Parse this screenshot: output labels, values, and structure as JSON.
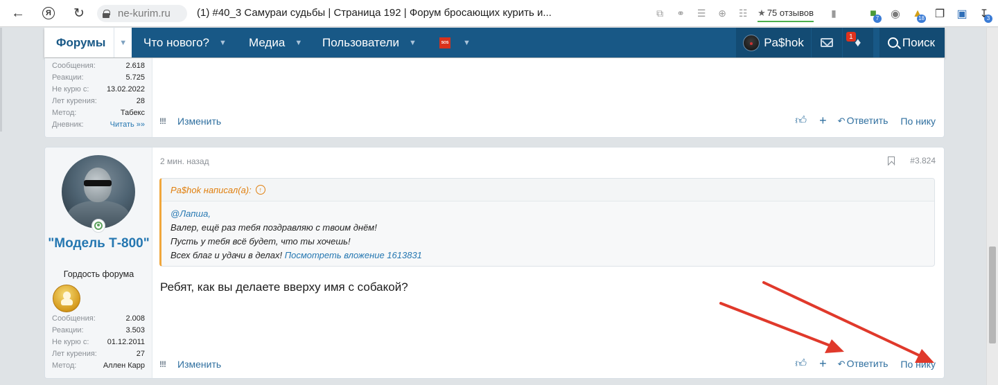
{
  "browser": {
    "domain": "ne-kurim.ru",
    "tab_title": "(1) #40_3 Самураи судьбы | Страница 192 | Форум бросающих курить и...",
    "reviews": "75 отзывов",
    "extension_badges": [
      "7",
      "18",
      "3"
    ]
  },
  "nav": {
    "forums": "Форумы",
    "whats_new": "Что нового?",
    "media": "Медиа",
    "members": "Пользователи",
    "sos": "SOS",
    "user": "Pa$hok",
    "alerts_badge": "1",
    "search": "Поиск"
  },
  "post1": {
    "stats": [
      {
        "key": "Сообщения:",
        "value": "2.618"
      },
      {
        "key": "Реакции:",
        "value": "5.725"
      },
      {
        "key": "Не курю с:",
        "value": "13.02.2022"
      },
      {
        "key": "Лет курения:",
        "value": "28"
      },
      {
        "key": "Метод:",
        "value": "Табекс"
      },
      {
        "key": "Дневник:",
        "value": "Читать »»"
      }
    ],
    "actions": {
      "report": "!!!",
      "edit": "Изменить",
      "reply": "Ответить",
      "by_nick": "По нику"
    }
  },
  "post2": {
    "author": {
      "name": "\"Модель Т-800\"",
      "title": "Гордость форума"
    },
    "stats": [
      {
        "key": "Сообщения:",
        "value": "2.008"
      },
      {
        "key": "Реакции:",
        "value": "3.503"
      },
      {
        "key": "Не курю с:",
        "value": "01.12.2011"
      },
      {
        "key": "Лет курения:",
        "value": "27"
      },
      {
        "key": "Метод:",
        "value": "Аллен Карр"
      }
    ],
    "time": "2 мин. назад",
    "number": "#3.824",
    "quote": {
      "author": "Pa$hok написал(а):",
      "mention": "@Лапша,",
      "lines": [
        "Валер, ещё раз тебя поздравляю с твоим днём!",
        "Пусть у тебя всё будет, что ты хочешь!",
        "Всех благ и удачи в делах!"
      ],
      "attachment": "Посмотреть вложение 1613831"
    },
    "message": "Ребят, как вы делаете вверху имя с собакой?",
    "actions": {
      "report": "!!!",
      "edit": "Изменить",
      "reply": "Ответить",
      "by_nick": "По нику"
    }
  },
  "colors": {
    "nav": "#185886",
    "link": "#2f6f9f",
    "quote_accent": "#f0a63c",
    "arrow": "#e0392b"
  }
}
